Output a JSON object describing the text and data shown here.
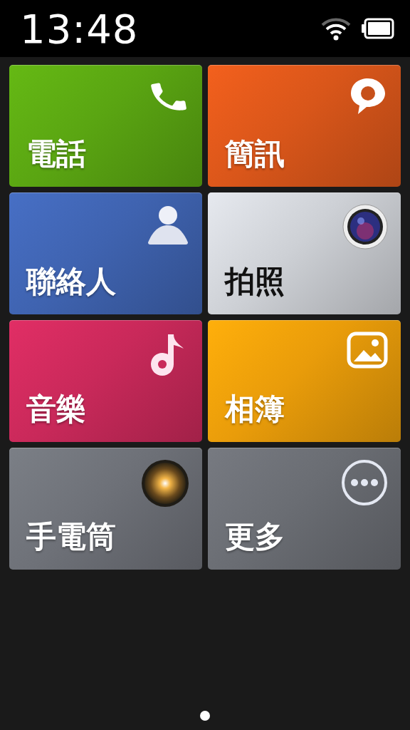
{
  "status_bar": {
    "time": "13:48"
  },
  "tiles": [
    {
      "label": "電話",
      "kind": "phone",
      "color": "#5aa512"
    },
    {
      "label": "簡訊",
      "kind": "message",
      "color": "#d9561a"
    },
    {
      "label": "聯絡人",
      "kind": "contact",
      "color": "#3f63b0"
    },
    {
      "label": "拍照",
      "kind": "camera",
      "color": "#cdd0d5"
    },
    {
      "label": "音樂",
      "kind": "music",
      "color": "#c9295a"
    },
    {
      "label": "相簿",
      "kind": "gallery",
      "color": "#e99c0a"
    },
    {
      "label": "手電筒",
      "kind": "flashlight",
      "color": "#6e7178"
    },
    {
      "label": "更多",
      "kind": "more",
      "color": "#6a6d73"
    }
  ],
  "pages": [
    {
      "selected": true
    }
  ]
}
